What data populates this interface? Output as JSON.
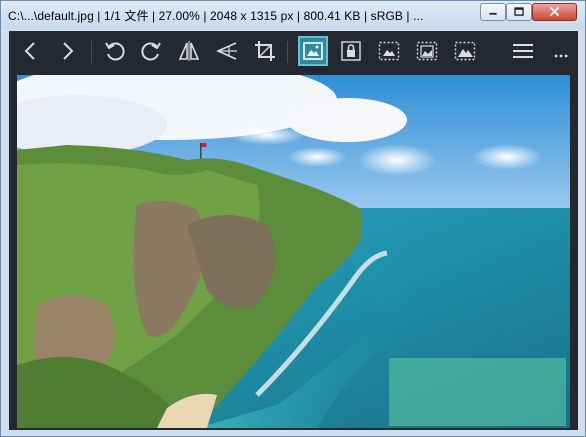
{
  "window": {
    "title": "C:\\...\\default.jpg  |  1/1 文件  |  27.00%  |  2048 x 1315 px  |  800.41 KB  |  sRGB  |  ..."
  },
  "window_controls": [
    "minimize-icon",
    "maximize-icon",
    "close-icon"
  ],
  "toolbar": {
    "buttons": [
      {
        "name": "previous",
        "icon": "chevron-left-icon"
      },
      {
        "name": "next",
        "icon": "chevron-right-icon"
      },
      {
        "name": "rotate-left",
        "icon": "rotate-ccw-icon"
      },
      {
        "name": "rotate-right",
        "icon": "rotate-cw-icon"
      },
      {
        "name": "flip-horizontal",
        "icon": "flip-horizontal-icon"
      },
      {
        "name": "flip-vertical",
        "icon": "flip-vertical-icon"
      },
      {
        "name": "crop",
        "icon": "crop-icon"
      },
      {
        "name": "fit-image",
        "icon": "image-fit-icon",
        "active": true
      },
      {
        "name": "lock-zoom",
        "icon": "lock-icon"
      },
      {
        "name": "zoom-option-1",
        "icon": "image-dashed-icon"
      },
      {
        "name": "zoom-option-2",
        "icon": "image-dashed-icon"
      },
      {
        "name": "zoom-option-3",
        "icon": "image-dashed-icon"
      },
      {
        "name": "menu",
        "icon": "hamburger-icon"
      },
      {
        "name": "more",
        "icon": "ellipsis-icon"
      }
    ],
    "accent_color": "#2e8aa0"
  },
  "image": {
    "subject": "coastal-cliff-photo"
  }
}
